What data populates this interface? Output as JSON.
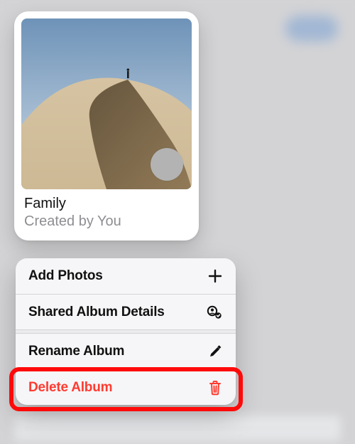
{
  "album": {
    "title": "Family",
    "subtitle": "Created by You"
  },
  "menu": {
    "add_photos": "Add Photos",
    "details": "Shared Album Details",
    "rename": "Rename Album",
    "delete": "Delete Album"
  },
  "colors": {
    "destructive": "#ff3b30",
    "highlight": "#ff0a0a"
  }
}
